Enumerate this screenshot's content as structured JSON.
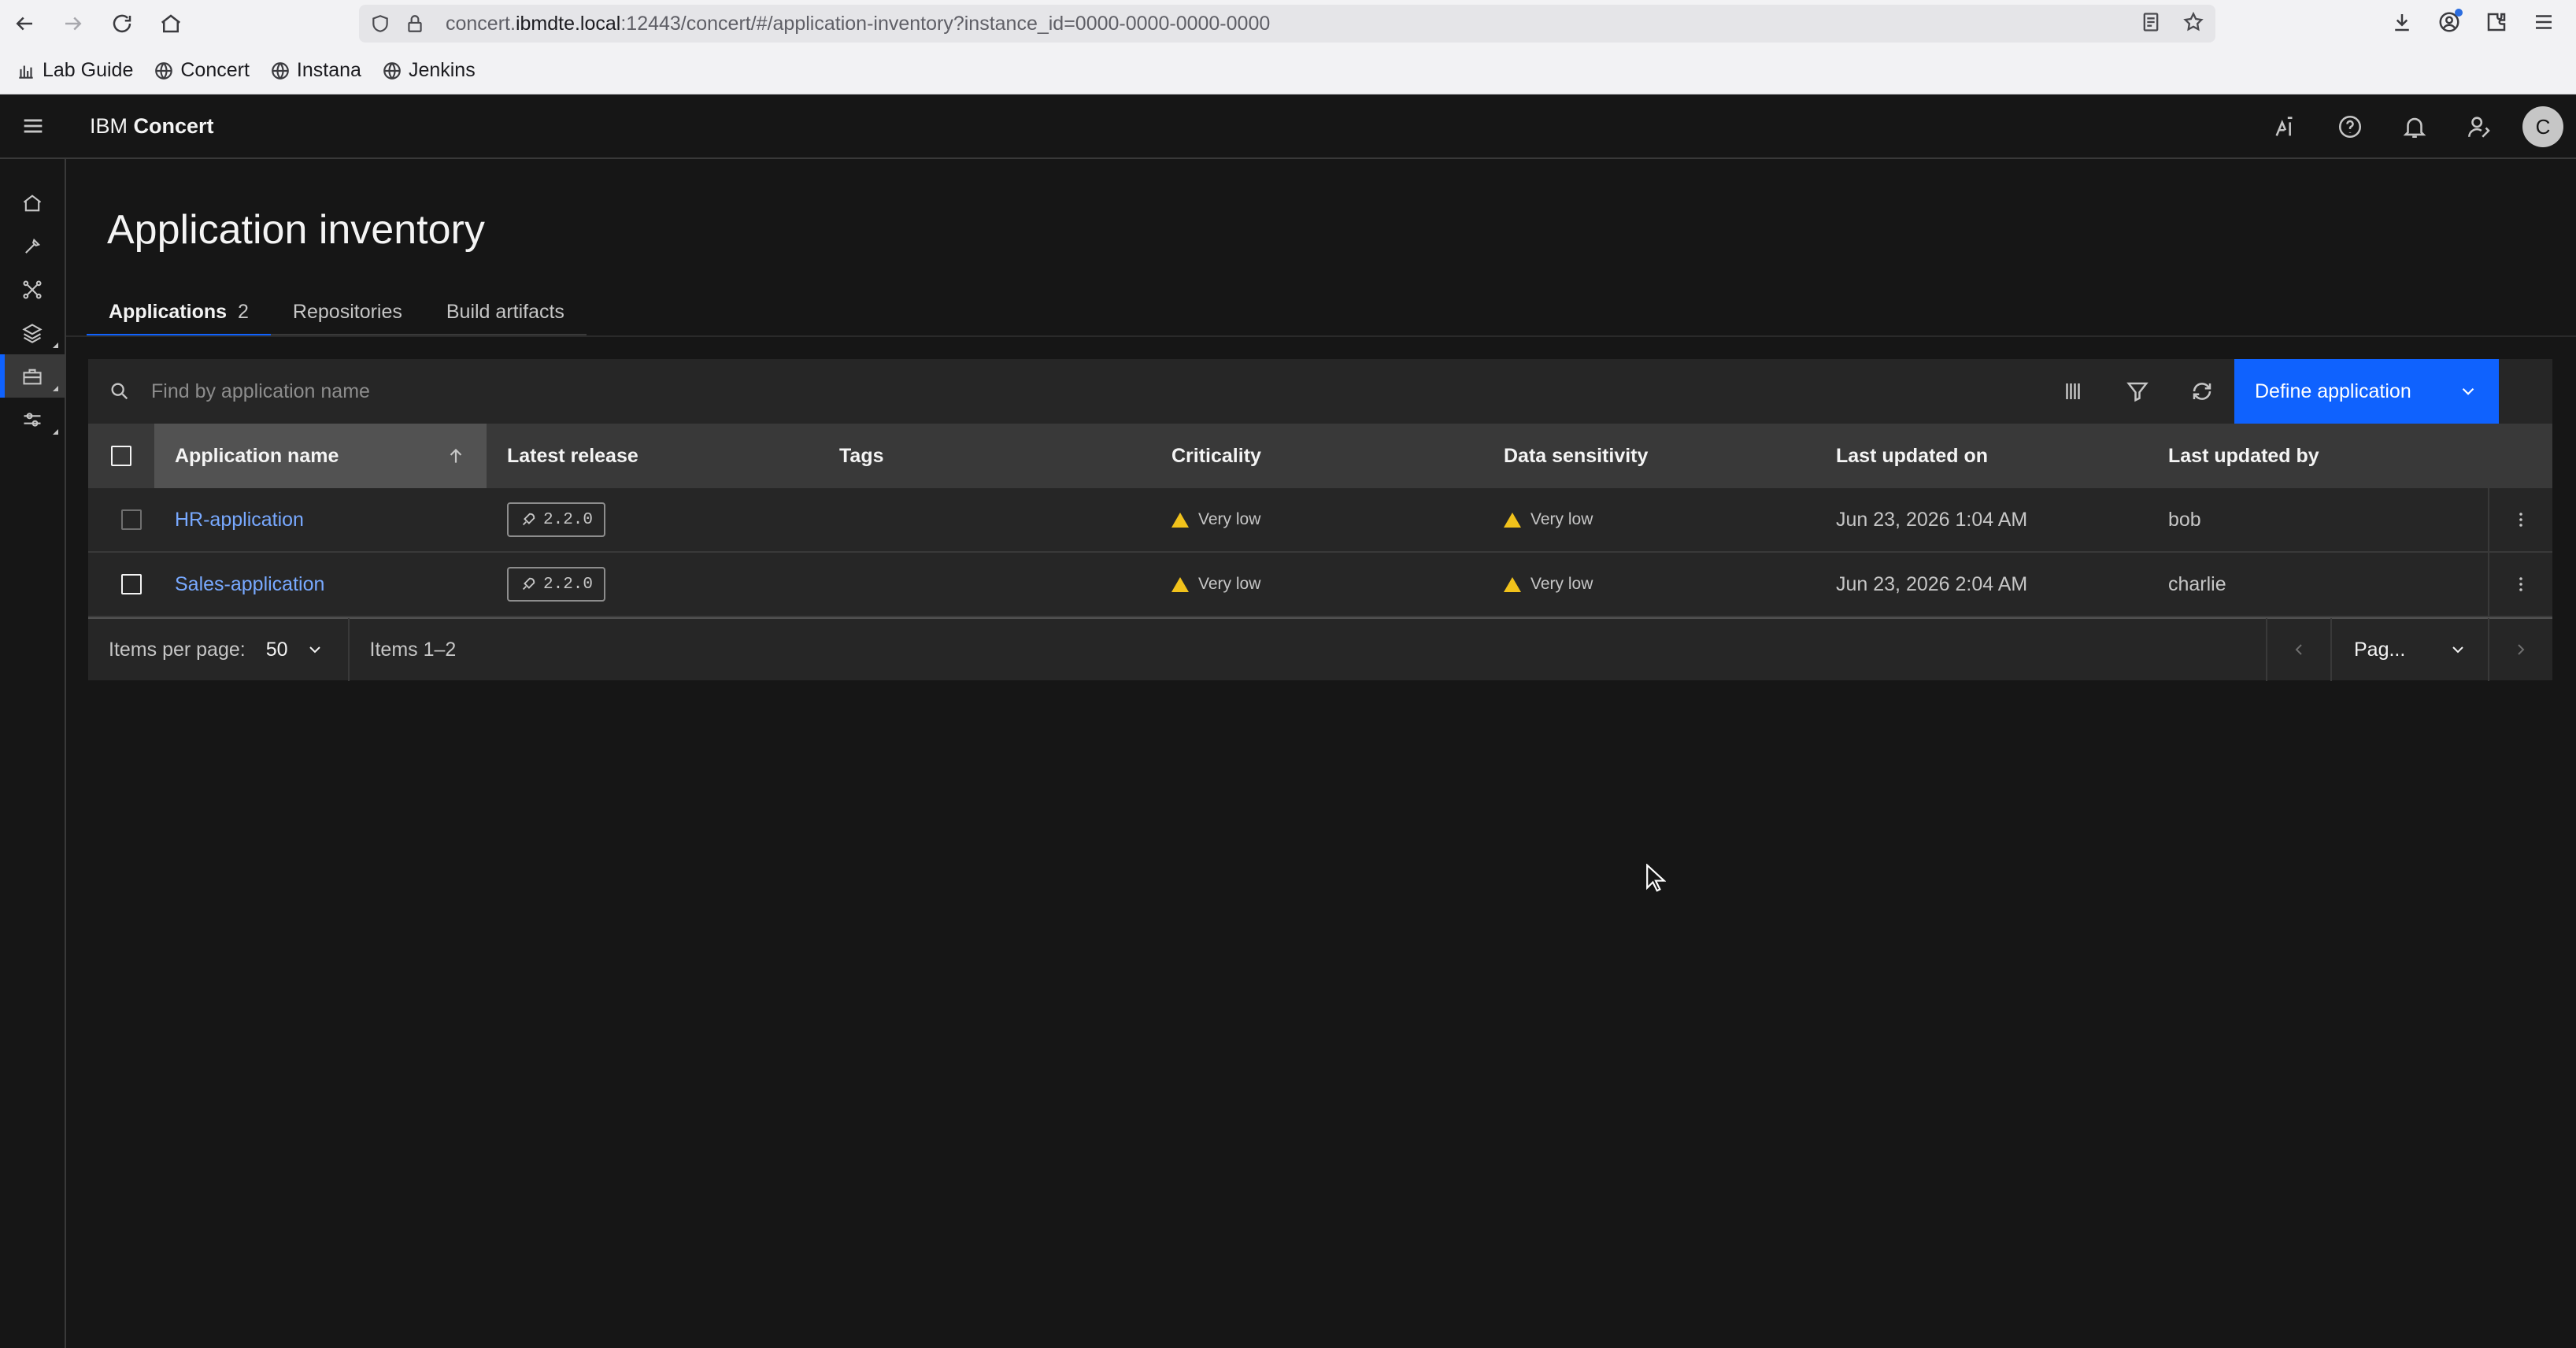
{
  "browser": {
    "url_prefix": "concert.",
    "url_host": "ibmdte.local",
    "url_rest": ":12443/concert/#/application-inventory?instance_id=0000-0000-0000-0000",
    "bookmarks": [
      "Lab Guide",
      "Concert",
      "Instana",
      "Jenkins"
    ]
  },
  "header": {
    "brand": "IBM",
    "product": "Concert",
    "avatar_initial": "C"
  },
  "page": {
    "title": "Application inventory",
    "tabs": [
      {
        "label": "Applications",
        "count": "2"
      },
      {
        "label": "Repositories"
      },
      {
        "label": "Build artifacts"
      }
    ]
  },
  "toolbar": {
    "search_placeholder": "Find by application name",
    "define_label": "Define application"
  },
  "table": {
    "columns": [
      "Application name",
      "Latest release",
      "Tags",
      "Criticality",
      "Data sensitivity",
      "Last updated on",
      "Last updated by"
    ],
    "rows": [
      {
        "name": "HR-application",
        "release": "2.2.0",
        "tags": "",
        "criticality": "Very low",
        "sensitivity": "Very low",
        "updated_on": "Jun 23, 2026 1:04 AM",
        "updated_by": "bob"
      },
      {
        "name": "Sales-application",
        "release": "2.2.0",
        "tags": "",
        "criticality": "Very low",
        "sensitivity": "Very low",
        "updated_on": "Jun 23, 2026 2:04 AM",
        "updated_by": "charlie"
      }
    ]
  },
  "pagination": {
    "items_per_page_label": "Items per page:",
    "items_per_page": "50",
    "range": "Items 1–2",
    "page_label": "Pag..."
  },
  "colors": {
    "accent": "#0f62fe",
    "link": "#78a9ff",
    "warning": "#f1c21b",
    "background": "#161616"
  }
}
